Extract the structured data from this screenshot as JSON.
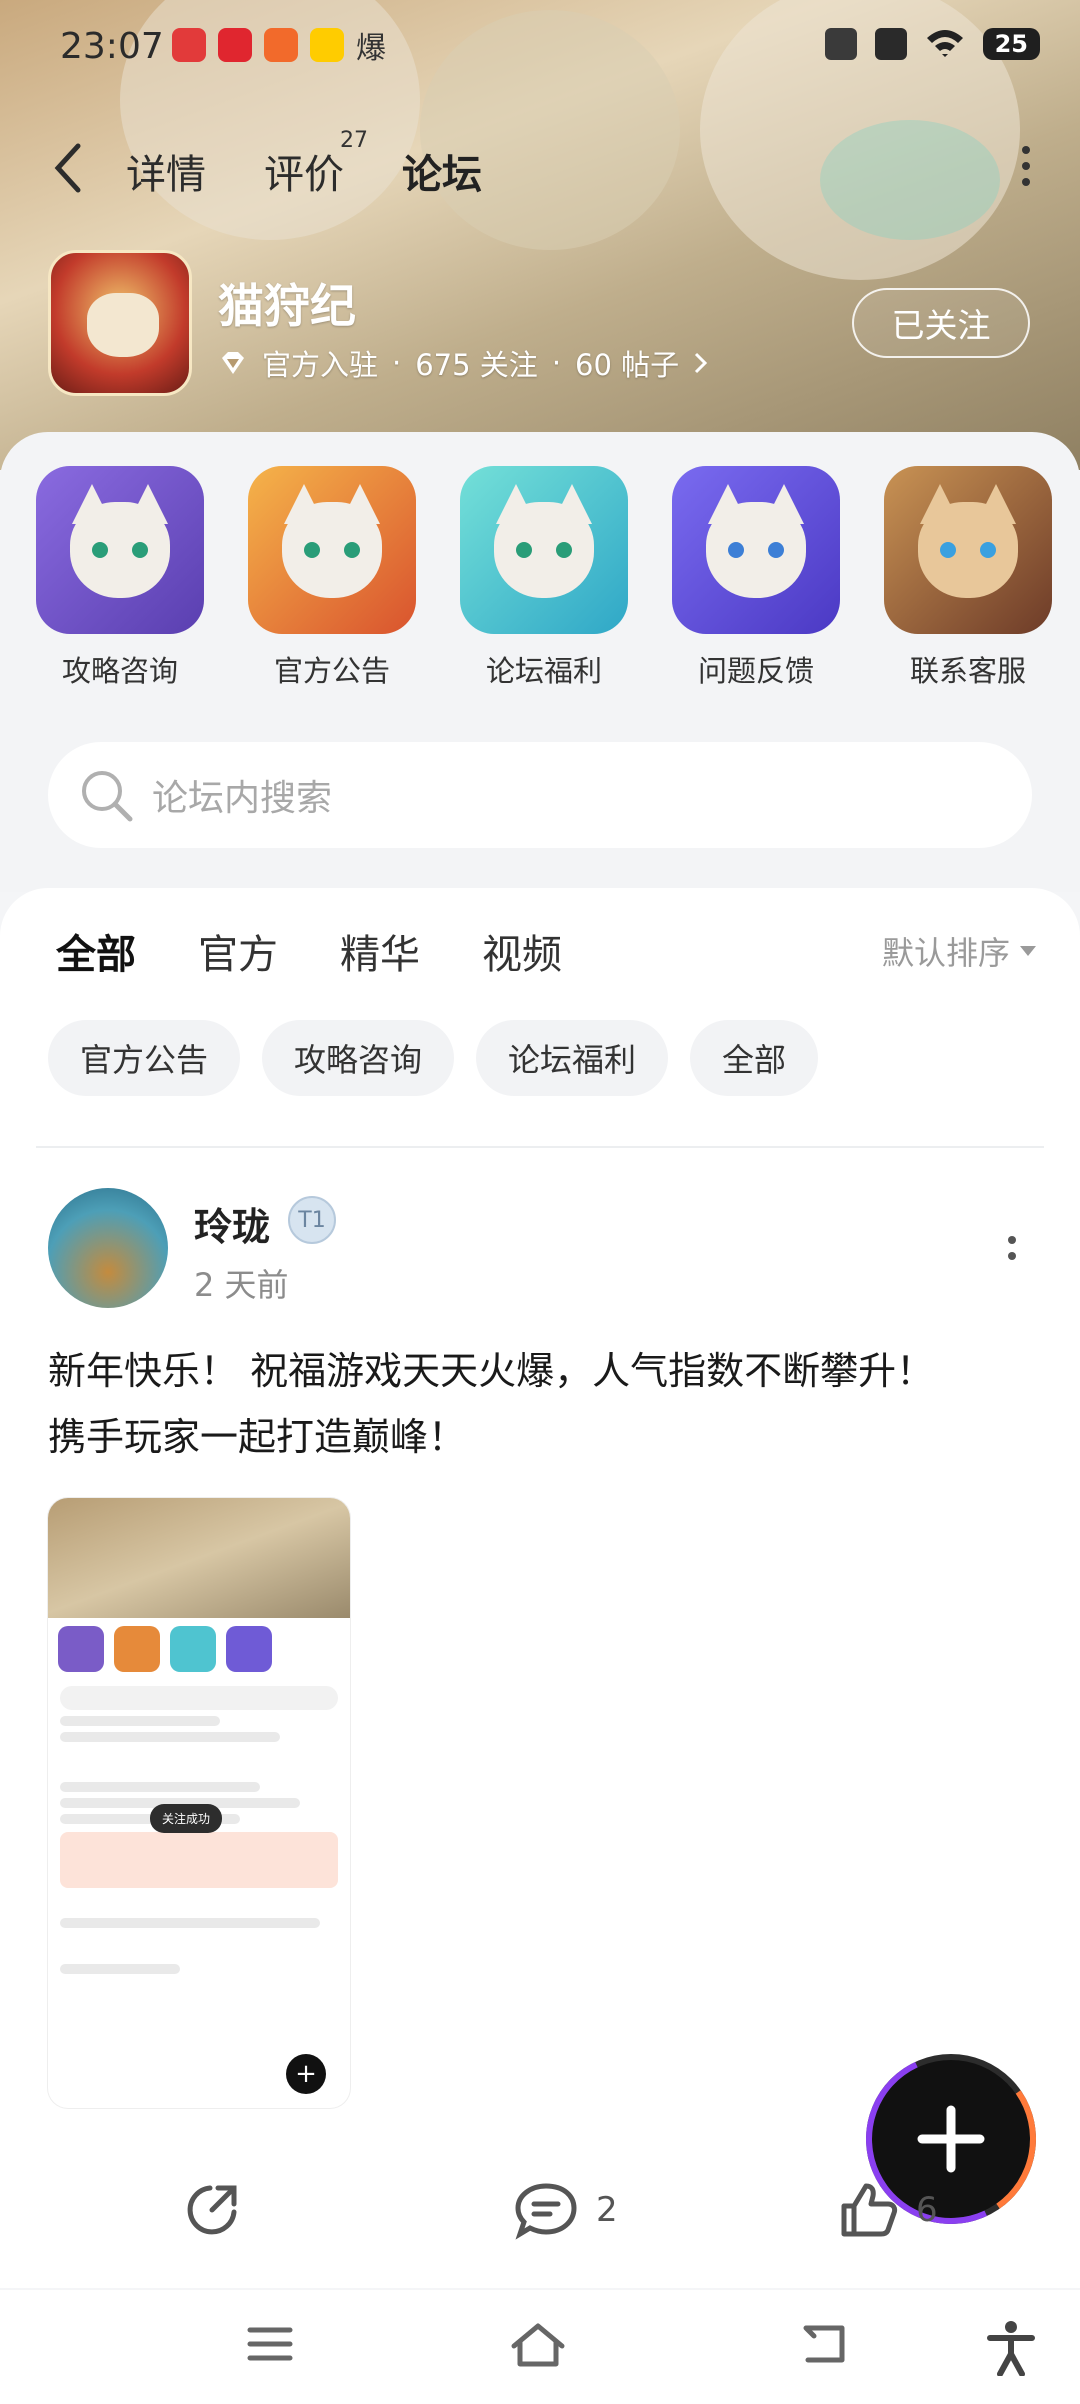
{
  "status_bar": {
    "time": "23:07",
    "notif_icons": [
      "app-icon-1",
      "app-icon-2",
      "app-icon-3",
      "weibo-icon"
    ],
    "notif_text": "爆",
    "battery": "25"
  },
  "nav": {
    "tabs": [
      {
        "label": "详情",
        "active": false
      },
      {
        "label": "评价",
        "active": false
      },
      {
        "label": "论坛",
        "active": true
      }
    ],
    "review_count": "27"
  },
  "app": {
    "name": "猫狩纪",
    "official": "官方入驻",
    "separator": "·",
    "followers": "675 关注",
    "posts": "60 帖子",
    "follow_button": "已关注"
  },
  "shortcuts": [
    {
      "label": "攻略咨询",
      "color": "#7a5cc7"
    },
    {
      "label": "官方公告",
      "color": "#e68a3a"
    },
    {
      "label": "论坛福利",
      "color": "#4fc4d0"
    },
    {
      "label": "问题反馈",
      "color": "#6f5bd6"
    },
    {
      "label": "联系客服",
      "color": "#c4863f"
    }
  ],
  "search": {
    "placeholder": "论坛内搜索"
  },
  "content_tabs": [
    {
      "label": "全部",
      "active": true
    },
    {
      "label": "官方",
      "active": false
    },
    {
      "label": "精华",
      "active": false
    },
    {
      "label": "视频",
      "active": false
    }
  ],
  "sort": {
    "label": "默认排序"
  },
  "chips": [
    "官方公告",
    "攻略咨询",
    "论坛福利",
    "全部"
  ],
  "post": {
    "author": "玲珑",
    "badge": "T1",
    "time": "2 天前",
    "text_line1": "新年快乐！ 祝福游戏天天火爆，人气指数不断攀升！",
    "text_line2": "携手玩家一起打造巅峰！",
    "image_toast": "关注成功",
    "comments": "2",
    "likes": "6"
  },
  "colors": {
    "accent": "#2fd5b8",
    "fab": "#111111"
  }
}
